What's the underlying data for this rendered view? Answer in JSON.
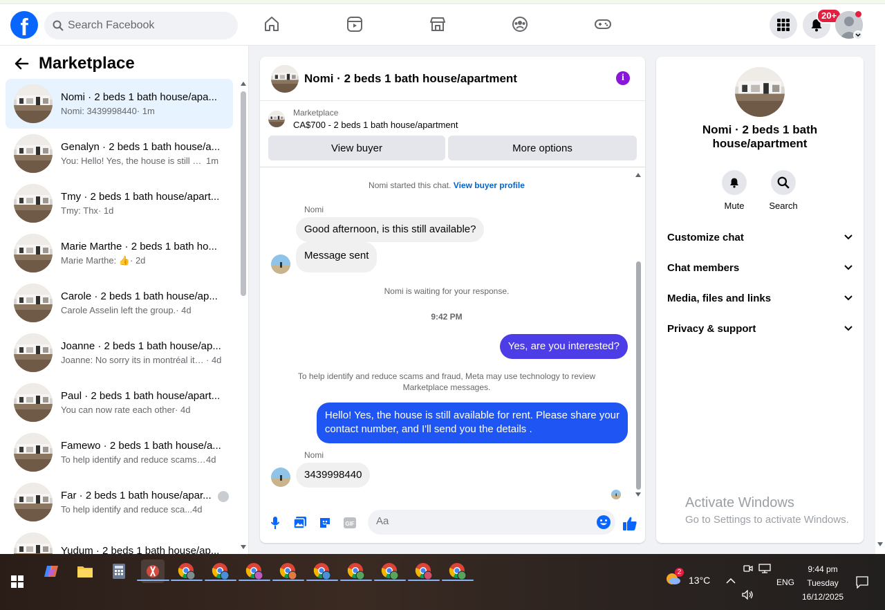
{
  "header": {
    "search_placeholder": "Search Facebook",
    "notification_badge": "20+",
    "logo_letter": "f"
  },
  "sidebar": {
    "title": "Marketplace",
    "conversations": [
      {
        "name": "Nomi · 2 beds 1 bath house/apa...",
        "snippet": "Nomi: 3439998440",
        "time": " · 1m",
        "active": true
      },
      {
        "name": "Genalyn · 2 beds 1 bath house/a...",
        "snippet": "You: Hello! Yes, the house is still av...",
        "time": " 1m"
      },
      {
        "name": "Tmy · 2 beds 1 bath house/apart...",
        "snippet": "Tmy: Thx",
        "time": " · 1d"
      },
      {
        "name": "Marie Marthe · 2 beds 1 bath ho...",
        "snippet": "Marie Marthe: 👍",
        "time": " · 2d"
      },
      {
        "name": "Carole · 2 beds 1 bath house/ap...",
        "snippet": "Carole Asselin left the group.",
        "time": " · 4d"
      },
      {
        "name": "Joanne · 2 beds 1 bath house/ap...",
        "snippet": "Joanne: No sorry its in montréal its...",
        "time": " · 4d"
      },
      {
        "name": "Paul · 2 beds 1 bath house/apart...",
        "snippet": "You can now rate each other",
        "time": " · 4d"
      },
      {
        "name": "Famewo · 2 beds 1 bath house/a...",
        "snippet": "To help identify and reduce scams ...",
        "time": " 4d"
      },
      {
        "name": "Far · 2 beds 1 bath house/apar...",
        "snippet": "To help identify and reduce sca...",
        "time": " 4d"
      },
      {
        "name": "Yudum · 2 beds 1 bath house/ap...",
        "snippet": "",
        "time": ""
      }
    ]
  },
  "chat": {
    "title": "Nomi · 2 beds 1 bath house/apartment",
    "listing_label": "Marketplace",
    "listing_price": "CA$700 - 2 beds 1 bath house/apartment",
    "view_buyer": "View buyer",
    "more_options": "More options",
    "started_text": "Nomi started this chat.",
    "view_profile": "View buyer profile",
    "sender_name": "Nomi",
    "msg1": "Good afternoon, is this still available?",
    "msg2": "Message sent",
    "waiting": "Nomi is waiting for your response.",
    "time": "9:42 PM",
    "msg3": "Yes, are you interested?",
    "scam_notice_1": "To help identify and reduce scams and fraud, Meta may use technology to review",
    "scam_notice_2": "Marketplace messages.",
    "msg4_line1": "Hello! Yes, the house is still available for rent. Please share your",
    "msg4_line2": "contact number, and I'll send you the details .",
    "msg5": "3439998440",
    "input_placeholder": "Aa"
  },
  "details": {
    "title_line1": "Nomi · 2 beds 1 bath",
    "title_line2": "house/apartment",
    "mute": "Mute",
    "search": "Search",
    "sections": [
      "Customize chat",
      "Chat members",
      "Media, files and links",
      "Privacy & support"
    ]
  },
  "watermark": {
    "line1": "Activate Windows",
    "line2": "Go to Settings to activate Windows."
  },
  "taskbar": {
    "weather": "13°C",
    "lang": "ENG",
    "time": "9:44 pm",
    "day": "Tuesday",
    "date": "16/12/2025",
    "weather_badge": "2"
  },
  "colors": {
    "brand": "#0866ff",
    "outgoing_purple": "#4c3de6",
    "outgoing_blue": "#1f55f2",
    "link": "#0064d1"
  }
}
